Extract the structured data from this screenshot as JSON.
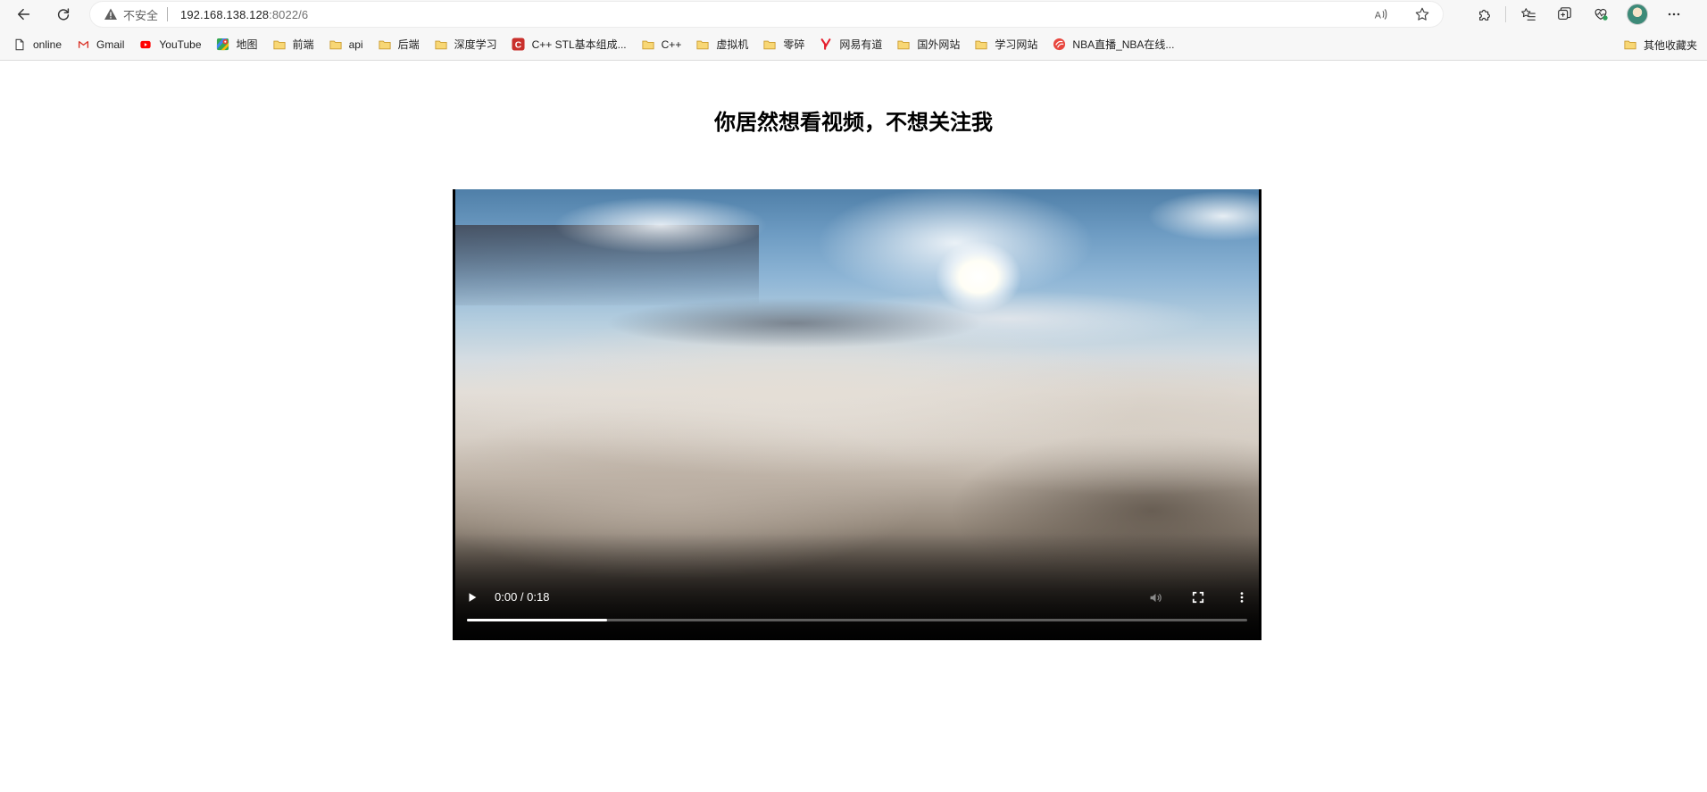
{
  "browser": {
    "security_label": "不安全",
    "url_host": "192.168.138.128",
    "url_rest": ":8022/6"
  },
  "bookmarks": [
    {
      "label": "online",
      "icon": "page-icon"
    },
    {
      "label": "Gmail",
      "icon": "gmail-icon"
    },
    {
      "label": "YouTube",
      "icon": "youtube-icon"
    },
    {
      "label": "地图",
      "icon": "maps-icon"
    },
    {
      "label": "前端",
      "icon": "folder-icon"
    },
    {
      "label": "api",
      "icon": "folder-icon"
    },
    {
      "label": "后端",
      "icon": "folder-icon"
    },
    {
      "label": "深度学习",
      "icon": "folder-icon"
    },
    {
      "label": "C++ STL基本组成...",
      "icon": "c-logo-icon"
    },
    {
      "label": "C++",
      "icon": "folder-icon"
    },
    {
      "label": "虚拟机",
      "icon": "folder-icon"
    },
    {
      "label": "零碎",
      "icon": "folder-icon"
    },
    {
      "label": "网易有道",
      "icon": "youdao-icon"
    },
    {
      "label": "国外网站",
      "icon": "folder-icon"
    },
    {
      "label": "学习网站",
      "icon": "folder-icon"
    },
    {
      "label": "NBA直播_NBA在线...",
      "icon": "nba-icon"
    }
  ],
  "other_bookmarks": "其他收藏夹",
  "page": {
    "title": "你居然想看视频，不想关注我"
  },
  "video": {
    "time": "0:00 / 0:18",
    "progress": 0.18
  },
  "colors": {
    "folder": "#f2c14e",
    "youtube": "#ff0000",
    "gmail": "#d93025",
    "youdao": "#e5202e"
  }
}
